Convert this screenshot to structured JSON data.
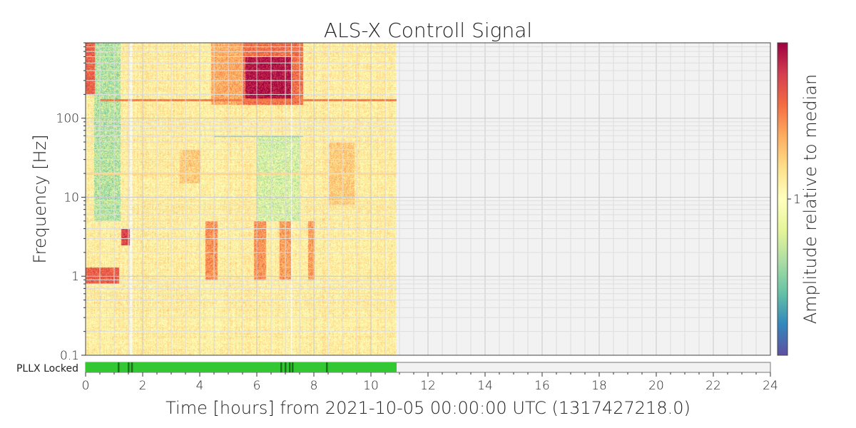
{
  "chart_data": {
    "type": "heatmap",
    "title": "ALS-X Controll Signal",
    "xlabel": "Time [hours] from 2021-10-05 00:00:00 UTC (1317427218.0)",
    "ylabel": "Frequency [Hz]",
    "y_scale": "log",
    "xlim": [
      0,
      24
    ],
    "ylim": [
      0.1,
      900
    ],
    "x_ticks": [
      "0",
      "2",
      "4",
      "6",
      "8",
      "10",
      "12",
      "14",
      "16",
      "18",
      "20",
      "22",
      "24"
    ],
    "x_tick_values": [
      0,
      2,
      4,
      6,
      8,
      10,
      12,
      14,
      16,
      18,
      20,
      22,
      24
    ],
    "y_ticks": [
      "0.1",
      "1",
      "10",
      "100"
    ],
    "y_tick_values": [
      0.1,
      1,
      10,
      100
    ],
    "grid": true,
    "data_end_hours": 10.9,
    "colorbar": {
      "label": "Amplitude relative to median",
      "colormap": "Spectral_r",
      "ticks": [
        "1"
      ],
      "tick_value": 1
    },
    "hot_regions": [
      {
        "x0": 0.0,
        "x1": 0.3,
        "f0": 200,
        "f1": 900,
        "level": 0.82
      },
      {
        "x0": 4.4,
        "x1": 5.6,
        "f0": 150,
        "f1": 900,
        "level": 0.7
      },
      {
        "x0": 5.5,
        "x1": 7.6,
        "f0": 150,
        "f1": 900,
        "level": 0.8
      },
      {
        "x0": 5.6,
        "x1": 7.2,
        "f0": 180,
        "f1": 600,
        "level": 0.97
      },
      {
        "x0": 0.0,
        "x1": 1.15,
        "f0": 0.8,
        "f1": 1.3,
        "level": 0.83
      },
      {
        "x0": 1.25,
        "x1": 1.55,
        "f0": 2.5,
        "f1": 4.0,
        "level": 0.88
      },
      {
        "x0": 4.2,
        "x1": 4.6,
        "f0": 0.9,
        "f1": 5.0,
        "level": 0.74
      },
      {
        "x0": 5.9,
        "x1": 6.3,
        "f0": 0.9,
        "f1": 5.0,
        "level": 0.74
      },
      {
        "x0": 6.8,
        "x1": 7.2,
        "f0": 0.9,
        "f1": 5.0,
        "level": 0.72
      },
      {
        "x0": 7.8,
        "x1": 8.0,
        "f0": 0.9,
        "f1": 5.0,
        "level": 0.72
      },
      {
        "x0": 3.3,
        "x1": 4.0,
        "f0": 15,
        "f1": 40,
        "level": 0.64
      },
      {
        "x0": 8.5,
        "x1": 9.4,
        "f0": 8,
        "f1": 50,
        "level": 0.64
      }
    ],
    "cool_regions": [
      {
        "x0": 0.3,
        "x1": 1.2,
        "f0": 5,
        "f1": 900,
        "level": 0.32
      },
      {
        "x0": 6.0,
        "x1": 7.5,
        "f0": 5,
        "f1": 60,
        "level": 0.38
      }
    ],
    "lines": [
      {
        "x0": 0.5,
        "x1": 10.9,
        "f": 170,
        "level": 0.78
      },
      {
        "x0": 4.5,
        "x1": 7.6,
        "f": 60,
        "level": 0.25
      },
      {
        "x0": 0.0,
        "x1": 10.9,
        "f": 20,
        "level": 0.62
      }
    ],
    "segments": {
      "label": "PLLX Locked",
      "color_on": "#33c733",
      "color_off": "#1e6e1e",
      "on": [
        0.0,
        10.9
      ],
      "off_marks": [
        1.15,
        1.5,
        1.62,
        6.85,
        7.0,
        7.15,
        7.25,
        8.45
      ]
    }
  }
}
